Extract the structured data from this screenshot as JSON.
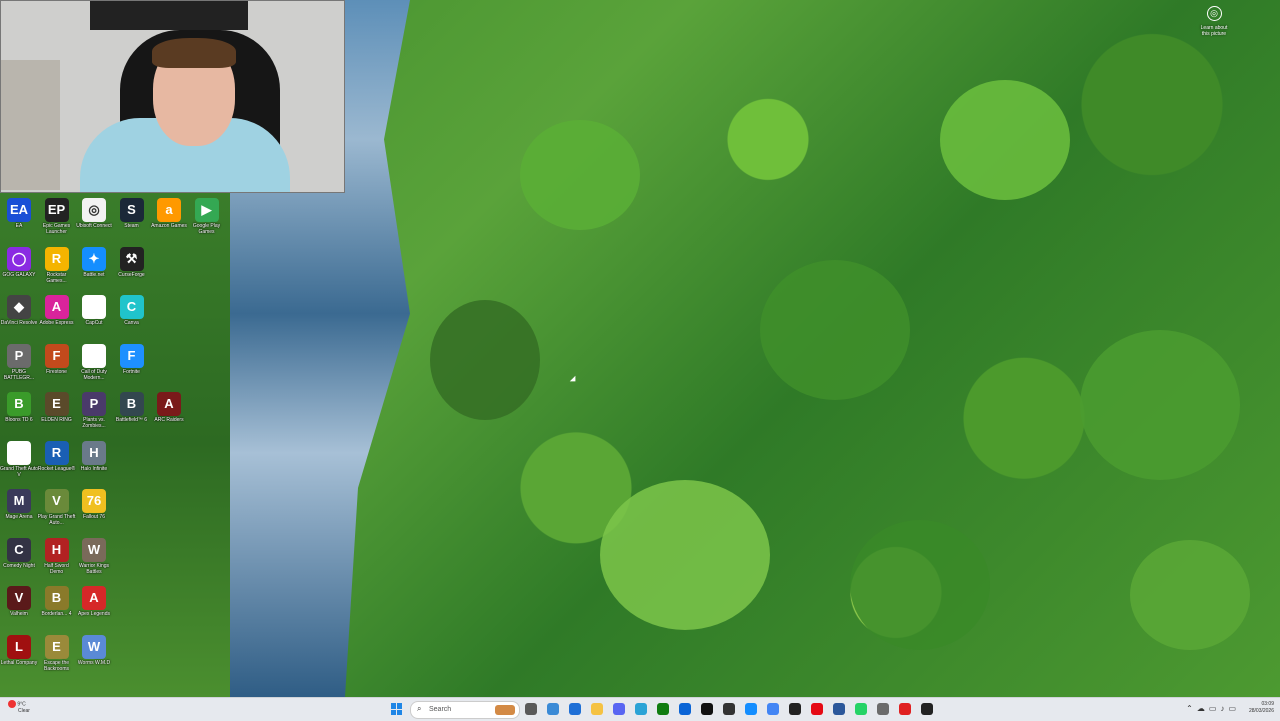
{
  "desktop": {
    "learn_about": "Learn about\nthis picture",
    "icons": [
      {
        "label": "EA",
        "color": "#1a4fd6",
        "glyph": "EA"
      },
      {
        "label": "Epic Games Launcher",
        "color": "#222222",
        "glyph": "EP"
      },
      {
        "label": "Ubisoft Connect",
        "color": "#f2f2f2",
        "glyph": "◎"
      },
      {
        "label": "Steam",
        "color": "#1b2838",
        "glyph": "S"
      },
      {
        "label": "Amazon Games",
        "color": "#ff9900",
        "glyph": "a"
      },
      {
        "label": "Google Play Games",
        "color": "#34a853",
        "glyph": "▶"
      },
      {
        "label": "GOG GALAXY",
        "color": "#8a2be2",
        "glyph": "◯"
      },
      {
        "label": "Rockstar Games...",
        "color": "#f4b400",
        "glyph": "R"
      },
      {
        "label": "Battle.net",
        "color": "#148eff",
        "glyph": "✦"
      },
      {
        "label": "CurseForge",
        "color": "#222222",
        "glyph": "⚒"
      },
      {
        "label": "DaVinci Resolve",
        "color": "#444444",
        "glyph": "◆"
      },
      {
        "label": "Adobe Express",
        "color": "#d9249b",
        "glyph": "A"
      },
      {
        "label": "CapCut",
        "color": "#ffffff",
        "glyph": ""
      },
      {
        "label": "Canva",
        "color": "#20c4cb",
        "glyph": "C"
      },
      {
        "label": "PUBG BATTLEGR...",
        "color": "#6b6b6b",
        "glyph": "P"
      },
      {
        "label": "Firestone",
        "color": "#c24a1c",
        "glyph": "F"
      },
      {
        "label": "Call of Duty Modern...",
        "color": "#ffffff",
        "glyph": ""
      },
      {
        "label": "Fortnite",
        "color": "#1e90ff",
        "glyph": "F"
      },
      {
        "label": "Bloons TD 6",
        "color": "#3a9b2a",
        "glyph": "B"
      },
      {
        "label": "ELDEN RING",
        "color": "#5a4a2a",
        "glyph": "E"
      },
      {
        "label": "Plants vs. Zombies...",
        "color": "#4a3a6a",
        "glyph": "P"
      },
      {
        "label": "Battlefield™ 6",
        "color": "#33474f",
        "glyph": "B"
      },
      {
        "label": "ARC Raiders",
        "color": "#7a1a1a",
        "glyph": "A"
      },
      {
        "label": "Grand Theft Auto V",
        "color": "#ffffff",
        "glyph": ""
      },
      {
        "label": "Rocket League®",
        "color": "#1a5fb4",
        "glyph": "R"
      },
      {
        "label": "Halo Infinite",
        "color": "#6a7a8a",
        "glyph": "H"
      },
      {
        "label": "Mage Arena",
        "color": "#3a3a5a",
        "glyph": "M"
      },
      {
        "label": "Play Grand Theft Auto...",
        "color": "#6a8a3a",
        "glyph": "V"
      },
      {
        "label": "Fallout 76",
        "color": "#f0c020",
        "glyph": "76"
      },
      {
        "label": "Comedy Night",
        "color": "#333344",
        "glyph": "C"
      },
      {
        "label": "Half Sword Demo",
        "color": "#b22222",
        "glyph": "H"
      },
      {
        "label": "Warrior Kings Battles",
        "color": "#7a6a5a",
        "glyph": "W"
      },
      {
        "label": "Valheim",
        "color": "#5a1a1a",
        "glyph": "V"
      },
      {
        "label": "Borderlan... 4",
        "color": "#8a7a2a",
        "glyph": "B"
      },
      {
        "label": "Apex Legends",
        "color": "#d62828",
        "glyph": "A"
      },
      {
        "label": "Lethal Company",
        "color": "#a01010",
        "glyph": "L"
      },
      {
        "label": "Escape the Backrooms",
        "color": "#9a8a3a",
        "glyph": "E"
      },
      {
        "label": "Worms W.M.D",
        "color": "#5a8ad6",
        "glyph": "W"
      }
    ]
  },
  "taskbar": {
    "weather_temp": "9°C",
    "weather_desc": "Clear",
    "search_placeholder": "Search",
    "time": "03:09",
    "date": "28/03/2026",
    "apps": [
      {
        "name": "task-view-icon",
        "color": "#5a5a5a"
      },
      {
        "name": "copilot-icon",
        "color": "#3a8ad6"
      },
      {
        "name": "file-explorer-icon",
        "color": "#1e6fd6"
      },
      {
        "name": "folder-icon",
        "color": "#f5c242"
      },
      {
        "name": "discord-icon",
        "color": "#5865f2"
      },
      {
        "name": "edge-icon",
        "color": "#2aa3d6"
      },
      {
        "name": "xbox-icon",
        "color": "#107c10"
      },
      {
        "name": "outlook-icon",
        "color": "#0a64d6"
      },
      {
        "name": "x-icon",
        "color": "#111111"
      },
      {
        "name": "obs-icon",
        "color": "#333333"
      },
      {
        "name": "battlenet-icon",
        "color": "#148eff"
      },
      {
        "name": "chrome-icon",
        "color": "#4285f4"
      },
      {
        "name": "capcut-icon",
        "color": "#222222"
      },
      {
        "name": "netflix-icon",
        "color": "#e50914"
      },
      {
        "name": "word-icon",
        "color": "#2b579a"
      },
      {
        "name": "whatsapp-icon",
        "color": "#25d366"
      },
      {
        "name": "settings-icon",
        "color": "#6b6b6b"
      },
      {
        "name": "recorder-icon",
        "color": "#e02020"
      },
      {
        "name": "terminal-icon",
        "color": "#222222"
      }
    ]
  }
}
